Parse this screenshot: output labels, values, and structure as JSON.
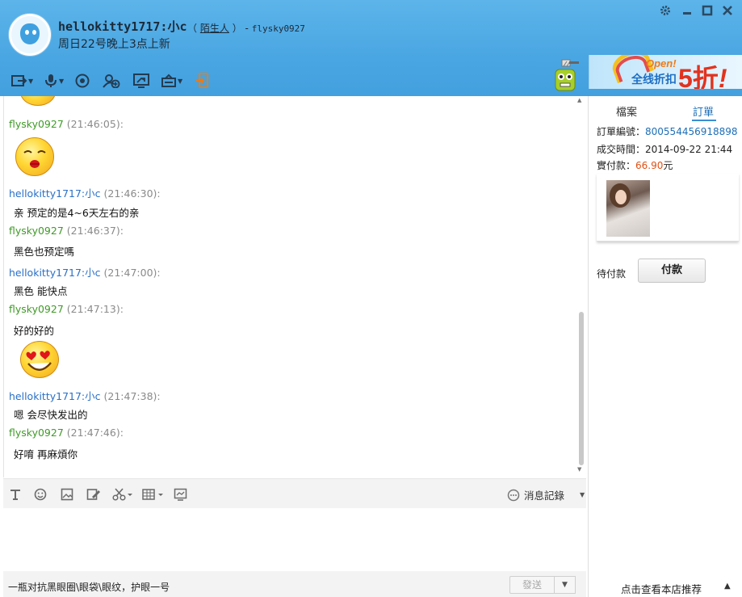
{
  "header": {
    "name": "hellokitty1717:小c",
    "tag_open": "（",
    "tag": "陌生人",
    "tag_close": "）",
    "sep": "-",
    "peer": "flysky0927",
    "subtitle": "周日22号晚上3点上新"
  },
  "window_buttons": [
    "gear-icon",
    "minimize-icon",
    "maximize-icon",
    "close-icon"
  ],
  "toolbar": [
    "file-transfer-icon",
    "microphone-icon",
    "camera-icon",
    "add-user-icon",
    "screen-share-icon",
    "remote-icon",
    "phone-icon"
  ],
  "banner": {
    "open": "Open!",
    "text": "全线折扣",
    "big": "5折",
    "bang": "!"
  },
  "messages": [
    {
      "name": "flysky0927",
      "time": "(21:46:05):",
      "body": "",
      "emoji": "kiss-emoji"
    },
    {
      "name": "hellokitty1717:小c",
      "time": "(21:46:30):",
      "body": "亲 预定的是4~6天左右的亲"
    },
    {
      "name": "flysky0927",
      "time": "(21:46:37):",
      "body": "黑色也预定嗎"
    },
    {
      "name": "hellokitty1717:小c",
      "time": "(21:47:00):",
      "body": "黑色 能快点"
    },
    {
      "name": "flysky0927",
      "time": "(21:47:13):",
      "body": "好的好的",
      "emoji": "heart-eyes-emoji"
    },
    {
      "name": "hellokitty1717:小c",
      "time": "(21:47:38):",
      "body": "嗯 会尽快发出的"
    },
    {
      "name": "flysky0927",
      "time": "(21:47:46):",
      "body": "好唷 再麻煩你"
    }
  ],
  "input_tools": [
    "font-icon",
    "emoji-icon",
    "image-icon",
    "edit-icon",
    "scissors-icon",
    "table-icon",
    "screenshot-icon"
  ],
  "history_label": "消息記錄",
  "footer": {
    "ad": "一瓶对抗黑眼圈\\眼袋\\眼纹，护眼一号",
    "send": "發送"
  },
  "right_panel": {
    "tab_profile": "檔案",
    "tab_order": "訂單",
    "order_no_label": "訂單編號：",
    "order_no": "800554456918898",
    "deal_time_label": "成交時間：",
    "deal_time": "2014-09-22 21:44",
    "paid_label": "實付款：",
    "paid_value": "66.90",
    "paid_unit": "元",
    "pending_label": "待付款",
    "pay_button": "付款",
    "recommend": "点击查看本店推荐"
  }
}
